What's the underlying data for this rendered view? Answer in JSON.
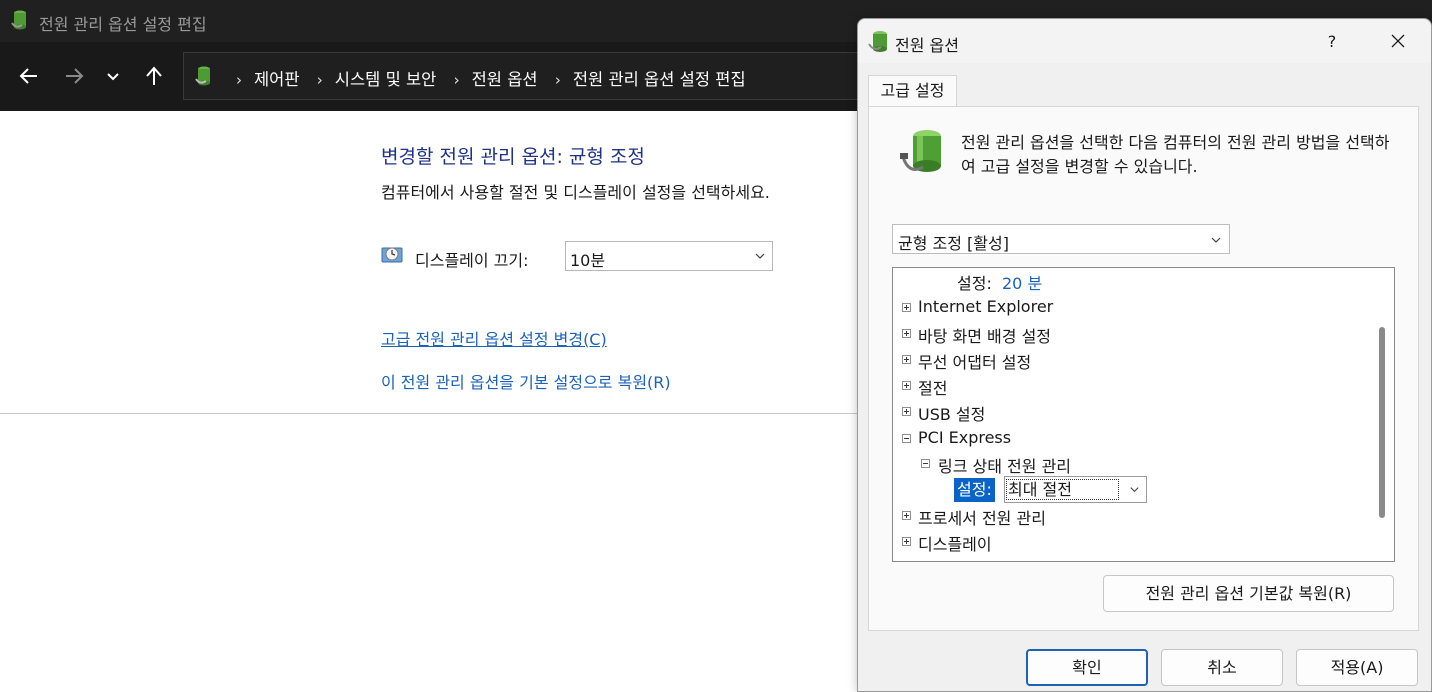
{
  "background_window": {
    "title": "전원 관리 옵션 설정 편집",
    "breadcrumbs": [
      "제어판",
      "시스템 및 보안",
      "전원 옵션",
      "전원 관리 옵션 설정 편집"
    ],
    "heading": "변경할 전원 관리 옵션: 균형 조정",
    "subtext": "컴퓨터에서 사용할 절전 및 디스플레이 설정을 선택하세요.",
    "display_off_label": "디스플레이 끄기:",
    "display_off_value": "10분",
    "link_advanced": "고급 전원 관리 옵션 설정 변경(C)",
    "link_restore": "이 전원 관리 옵션을 기본 설정으로 복원(R)"
  },
  "dialog": {
    "title": "전원 옵션",
    "help": "?",
    "tab": "고급 설정",
    "description": "전원 관리 옵션을 선택한 다음 컴퓨터의 전원 관리 방법을 선택하여 고급 설정을 변경할 수 있습니다.",
    "plan_select": "균형 조정 [활성]",
    "tree": {
      "top_setting_label": "설정:",
      "top_setting_value": "20 분",
      "items": [
        "Internet Explorer",
        "바탕 화면 배경 설정",
        "무선 어댑터 설정",
        "절전",
        "USB 설정",
        "PCI Express"
      ],
      "child": "링크 상태 전원 관리",
      "child_setting_label": "설정:",
      "child_setting_value": "최대 절전",
      "after_items": [
        "프로세서 전원 관리",
        "디스플레이"
      ]
    },
    "restore_button": "전원 관리 옵션 기본값 복원(R)",
    "ok_button": "확인",
    "cancel_button": "취소",
    "apply_button": "적용(A)"
  },
  "colors": {
    "heading_blue": "#1e3287",
    "link_blue": "#1c62b9",
    "selection": "#0a64c8",
    "titlebar_dark": "#202020"
  },
  "icons": [
    "power-options-icon",
    "back-arrow-icon",
    "forward-arrow-icon",
    "chevron-down-icon",
    "up-arrow-icon",
    "display-clock-icon",
    "close-icon",
    "expand-plus-icon",
    "collapse-minus-icon"
  ]
}
